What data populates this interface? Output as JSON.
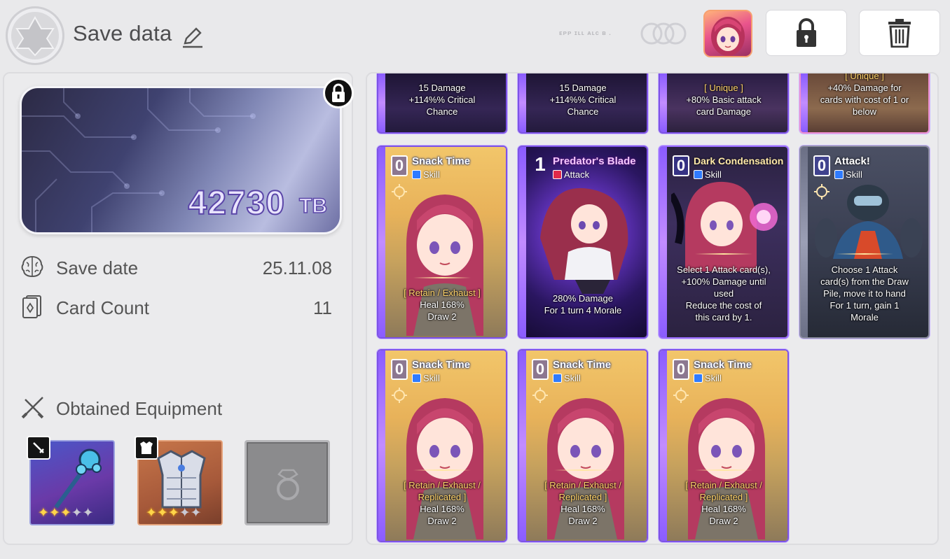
{
  "header": {
    "title": "Save data",
    "faint_text": "ᴇᴘᴘ ɪʟʟ ᴀʟᴄ ʙ .",
    "colors": {
      "background": "#e9e9eb",
      "button_bg": "#ffffff"
    },
    "icons": [
      "hexagram-emblem-icon",
      "pencil-icon",
      "rings-icon",
      "lock-icon",
      "trash-icon"
    ]
  },
  "wallet": {
    "value": "42730",
    "unit": "TB"
  },
  "stats": {
    "save_date_label": "Save date",
    "save_date_value": "25.11.08",
    "card_count_label": "Card Count",
    "card_count_value": "11"
  },
  "equipment": {
    "title": "Obtained Equipment",
    "weapon": {
      "stars_filled": 3,
      "stars_total": 5,
      "icon": "sword-icon"
    },
    "armor": {
      "stars_filled": 3,
      "stars_total": 5,
      "icon": "armor-icon"
    },
    "accessory": {
      "icon": "ring-icon",
      "empty": true
    }
  },
  "cards_top": [
    {
      "line1": "15 Damage",
      "line2": "+114%% Critical",
      "line3": "Chance"
    },
    {
      "line1": "15 Damage",
      "line2": "+114%% Critical",
      "line3": "Chance"
    },
    {
      "line1": "[ Unique ]",
      "line2": "+80% Basic attack",
      "line3": "card Damage"
    },
    {
      "line0": "[ Unique ]",
      "line1": "+40% Damage for",
      "line2": "cards with cost of 1 or",
      "line3": "below"
    }
  ],
  "cards_row2": [
    {
      "cost": "0",
      "name": "Snack Time",
      "type": "Skill",
      "tag": "[ Retain / Exhaust ]",
      "d1": "Heal 168%",
      "d2": "Draw 2"
    },
    {
      "cost": "1",
      "name": "Predator's Blade",
      "type": "Attack",
      "d1": "280% Damage",
      "d2": "For 1 turn 4 Morale"
    },
    {
      "cost": "0",
      "name": "Dark Condensation",
      "type": "Skill",
      "d1": "Select 1 Attack card(s),",
      "d2": "+100% Damage until",
      "d3": "used",
      "d4": "Reduce the cost of",
      "d5": "this card by 1."
    },
    {
      "cost": "0",
      "name": "Attack!",
      "type": "Skill",
      "d1": "Choose 1 Attack",
      "d2": "card(s) from the Draw",
      "d3": "Pile, move it to hand",
      "d4": "For 1 turn, gain 1",
      "d5": "Morale"
    }
  ],
  "cards_row3": [
    {
      "cost": "0",
      "name": "Snack Time",
      "type": "Skill",
      "tag1": "[ Retain / Exhaust /",
      "tag2": "Replicated ]",
      "d1": "Heal 168%",
      "d2": "Draw 2"
    },
    {
      "cost": "0",
      "name": "Snack Time",
      "type": "Skill",
      "tag1": "[ Retain / Exhaust /",
      "tag2": "Replicated ]",
      "d1": "Heal 168%",
      "d2": "Draw 2"
    },
    {
      "cost": "0",
      "name": "Snack Time",
      "type": "Skill",
      "tag1": "[ Retain / Exhaust /",
      "tag2": "Replicated ]",
      "d1": "Heal 168%",
      "d2": "Draw 2"
    }
  ]
}
